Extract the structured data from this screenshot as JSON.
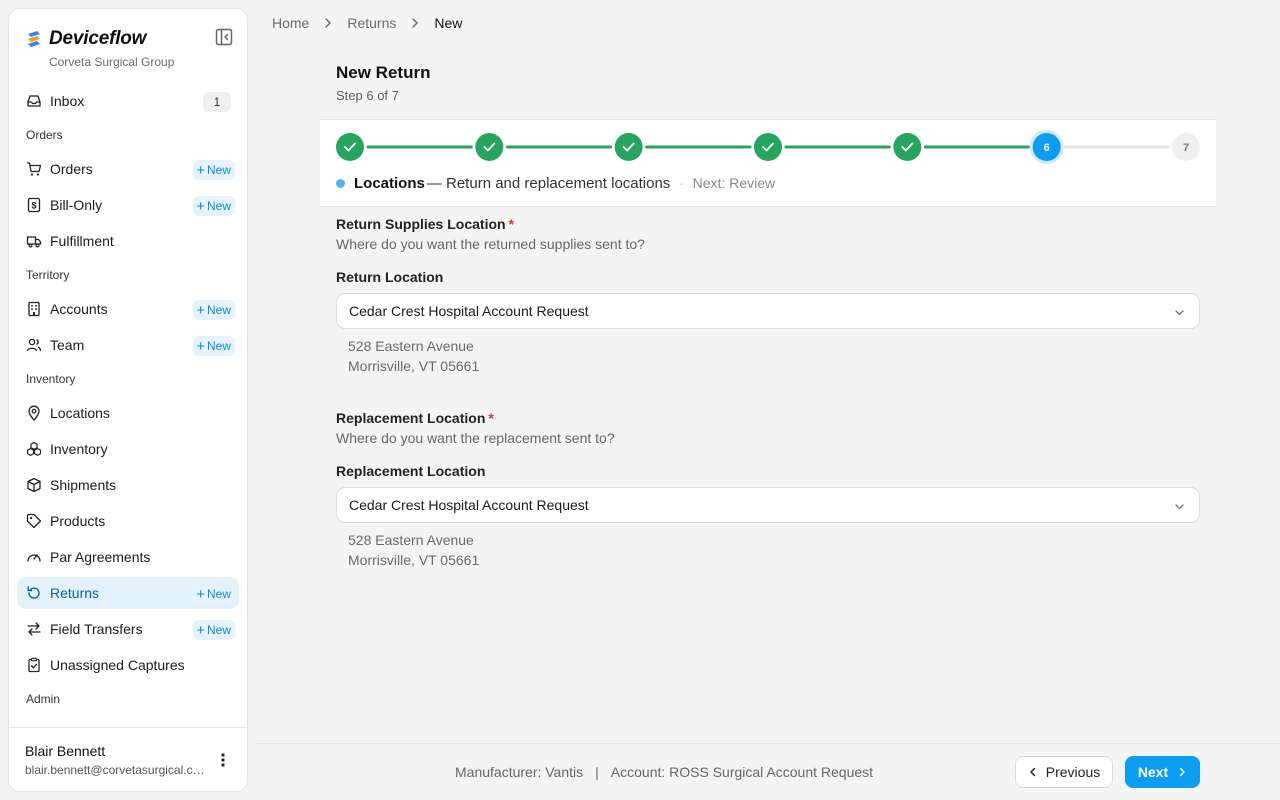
{
  "brand": {
    "name": "Deviceflow",
    "org": "Corveta Surgical Group"
  },
  "sidebar": {
    "items": [
      {
        "type": "item",
        "key": "inbox",
        "label": "Inbox",
        "icon": "inbox-icon",
        "badge": "1"
      },
      {
        "type": "section",
        "label": "Orders"
      },
      {
        "type": "item",
        "key": "orders",
        "label": "Orders",
        "icon": "cart-icon",
        "new": "New"
      },
      {
        "type": "item",
        "key": "bill-only",
        "label": "Bill-Only",
        "icon": "invoice-icon",
        "new": "New"
      },
      {
        "type": "item",
        "key": "fulfillment",
        "label": "Fulfillment",
        "icon": "truck-icon"
      },
      {
        "type": "section",
        "label": "Territory"
      },
      {
        "type": "item",
        "key": "accounts",
        "label": "Accounts",
        "icon": "building-icon",
        "new": "New"
      },
      {
        "type": "item",
        "key": "team",
        "label": "Team",
        "icon": "users-icon",
        "new": "New"
      },
      {
        "type": "section",
        "label": "Inventory"
      },
      {
        "type": "item",
        "key": "locations",
        "label": "Locations",
        "icon": "map-pin-icon"
      },
      {
        "type": "item",
        "key": "inventory",
        "label": "Inventory",
        "icon": "boxes-icon"
      },
      {
        "type": "item",
        "key": "shipments",
        "label": "Shipments",
        "icon": "package-icon"
      },
      {
        "type": "item",
        "key": "products",
        "label": "Products",
        "icon": "tag-icon"
      },
      {
        "type": "item",
        "key": "par-agreements",
        "label": "Par Agreements",
        "icon": "gauge-icon"
      },
      {
        "type": "item",
        "key": "returns",
        "label": "Returns",
        "icon": "return-icon",
        "new": "New",
        "active": true
      },
      {
        "type": "item",
        "key": "field-transfers",
        "label": "Field Transfers",
        "icon": "transfer-icon",
        "new": "New"
      },
      {
        "type": "item",
        "key": "unassigned-captures",
        "label": "Unassigned Captures",
        "icon": "clipboard-icon"
      },
      {
        "type": "section",
        "label": "Admin"
      }
    ]
  },
  "user": {
    "name": "Blair Bennett",
    "email": "blair.bennett@corvetasurgical.com"
  },
  "breadcrumb": [
    "Home",
    "Returns",
    "New"
  ],
  "page": {
    "title": "New Return",
    "step": "Step 6 of 7"
  },
  "stepper": {
    "total": 7,
    "current": 6,
    "current_title": "Locations",
    "current_desc": "— Return and replacement locations",
    "separator": "·",
    "next": "Next: Review",
    "colors": {
      "done": "#27a55f",
      "current": "#0c9cf0",
      "pending": "#efefef"
    }
  },
  "return_section": {
    "title": "Return Supplies Location",
    "required": "*",
    "subtitle": "Where do you want the returned supplies sent to?",
    "field_label": "Return Location",
    "value": "Cedar Crest Hospital Account Request",
    "address_line1": "528 Eastern Avenue",
    "address_line2": "Morrisville, VT 05661"
  },
  "replacement_section": {
    "title": "Replacement Location",
    "required": "*",
    "subtitle": "Where do you want the replacement sent to?",
    "field_label": "Replacement Location",
    "value": "Cedar Crest Hospital Account Request",
    "address_line1": "528 Eastern Avenue",
    "address_line2": "Morrisville, VT 05661"
  },
  "footer": {
    "manufacturer": "Manufacturer: Vantis",
    "separator": "|",
    "account": "Account: ROSS Surgical Account Request",
    "previous_label": "Previous",
    "next_label": "Next"
  }
}
